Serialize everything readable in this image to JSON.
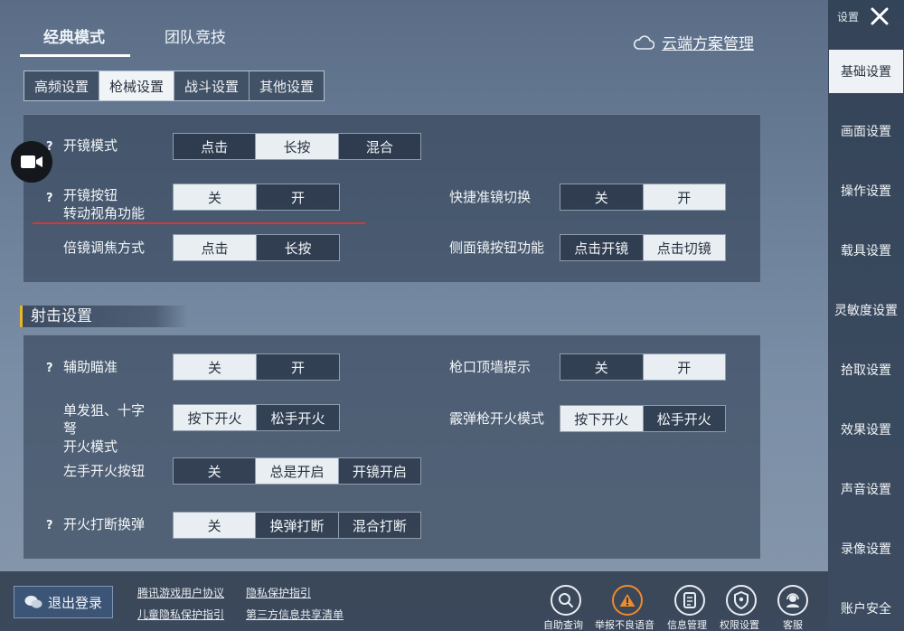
{
  "header": {
    "tabs": [
      {
        "label": "经典模式",
        "active": true
      },
      {
        "label": "团队竞技",
        "active": false
      }
    ],
    "cloud_label": "云端方案管理"
  },
  "subtabs": [
    {
      "label": "高频设置",
      "active": false
    },
    {
      "label": "枪械设置",
      "active": true
    },
    {
      "label": "战斗设置",
      "active": false
    },
    {
      "label": "其他设置",
      "active": false
    }
  ],
  "scope": {
    "open_mode": {
      "label": "开镜模式",
      "options": [
        "点击",
        "长按",
        "混合"
      ],
      "selected": 1
    },
    "open_button_rotate": {
      "label_line1": "开镜按钮",
      "label_line2": "转动视角功能",
      "options": [
        "关",
        "开"
      ],
      "selected": 0
    },
    "quick_switch": {
      "label": "快捷准镜切换",
      "options": [
        "关",
        "开"
      ],
      "selected": 1
    },
    "zoom_focus": {
      "label": "倍镜调焦方式",
      "options": [
        "点击",
        "长按"
      ],
      "selected": 0
    },
    "side_scope_button": {
      "label": "侧面镜按钮功能",
      "options": [
        "点击开镜",
        "点击切镜"
      ],
      "selected": 1
    }
  },
  "shooting": {
    "section_title": "射击设置",
    "aim_assist": {
      "label": "辅助瞄准",
      "options": [
        "关",
        "开"
      ],
      "selected": 0
    },
    "muzzle_wall": {
      "label": "枪口顶墙提示",
      "options": [
        "关",
        "开"
      ],
      "selected": 1
    },
    "single_sniper": {
      "label_line1": "单发狙、十字",
      "label_line2": "弩",
      "label_line3": "开火模式",
      "options": [
        "按下开火",
        "松手开火"
      ],
      "selected": 0
    },
    "shotgun_mode": {
      "label": "霰弹枪开火模式",
      "options": [
        "按下开火",
        "松手开火"
      ],
      "selected": 0
    },
    "left_fire": {
      "label": "左手开火按钮",
      "options": [
        "关",
        "总是开启",
        "开镜开启"
      ],
      "selected": 1
    },
    "interrupt_reload": {
      "label": "开火打断换弹",
      "options": [
        "关",
        "换弹打断",
        "混合打断"
      ],
      "selected": 0
    }
  },
  "help_mark": "?",
  "sidebar": {
    "top_label": "设置",
    "items": [
      {
        "label": "基础设置",
        "active": true
      },
      {
        "label": "画面设置",
        "active": false
      },
      {
        "label": "操作设置",
        "active": false
      },
      {
        "label": "载具设置",
        "active": false
      },
      {
        "label": "灵敏度设置",
        "active": false
      },
      {
        "label": "拾取设置",
        "active": false
      },
      {
        "label": "效果设置",
        "active": false
      },
      {
        "label": "声音设置",
        "active": false
      },
      {
        "label": "录像设置",
        "active": false
      },
      {
        "label": "账户安全",
        "active": false
      }
    ]
  },
  "footer": {
    "logout": "退出登录",
    "links": [
      "腾讯游戏用户协议",
      "隐私保护指引",
      "儿童隐私保护指引",
      "第三方信息共享清单"
    ],
    "icons": [
      {
        "label": "自助查询",
        "icon": "search-icon"
      },
      {
        "label": "举报不良语音",
        "icon": "warning-icon"
      },
      {
        "label": "信息管理",
        "icon": "info-manage-icon"
      },
      {
        "label": "权限设置",
        "icon": "permission-icon"
      },
      {
        "label": "客服",
        "icon": "support-icon"
      }
    ]
  },
  "colors": {
    "accent_yellow": "#e7b52e",
    "red_underline": "#d23a3a",
    "warn_orange": "#f08a2a"
  }
}
